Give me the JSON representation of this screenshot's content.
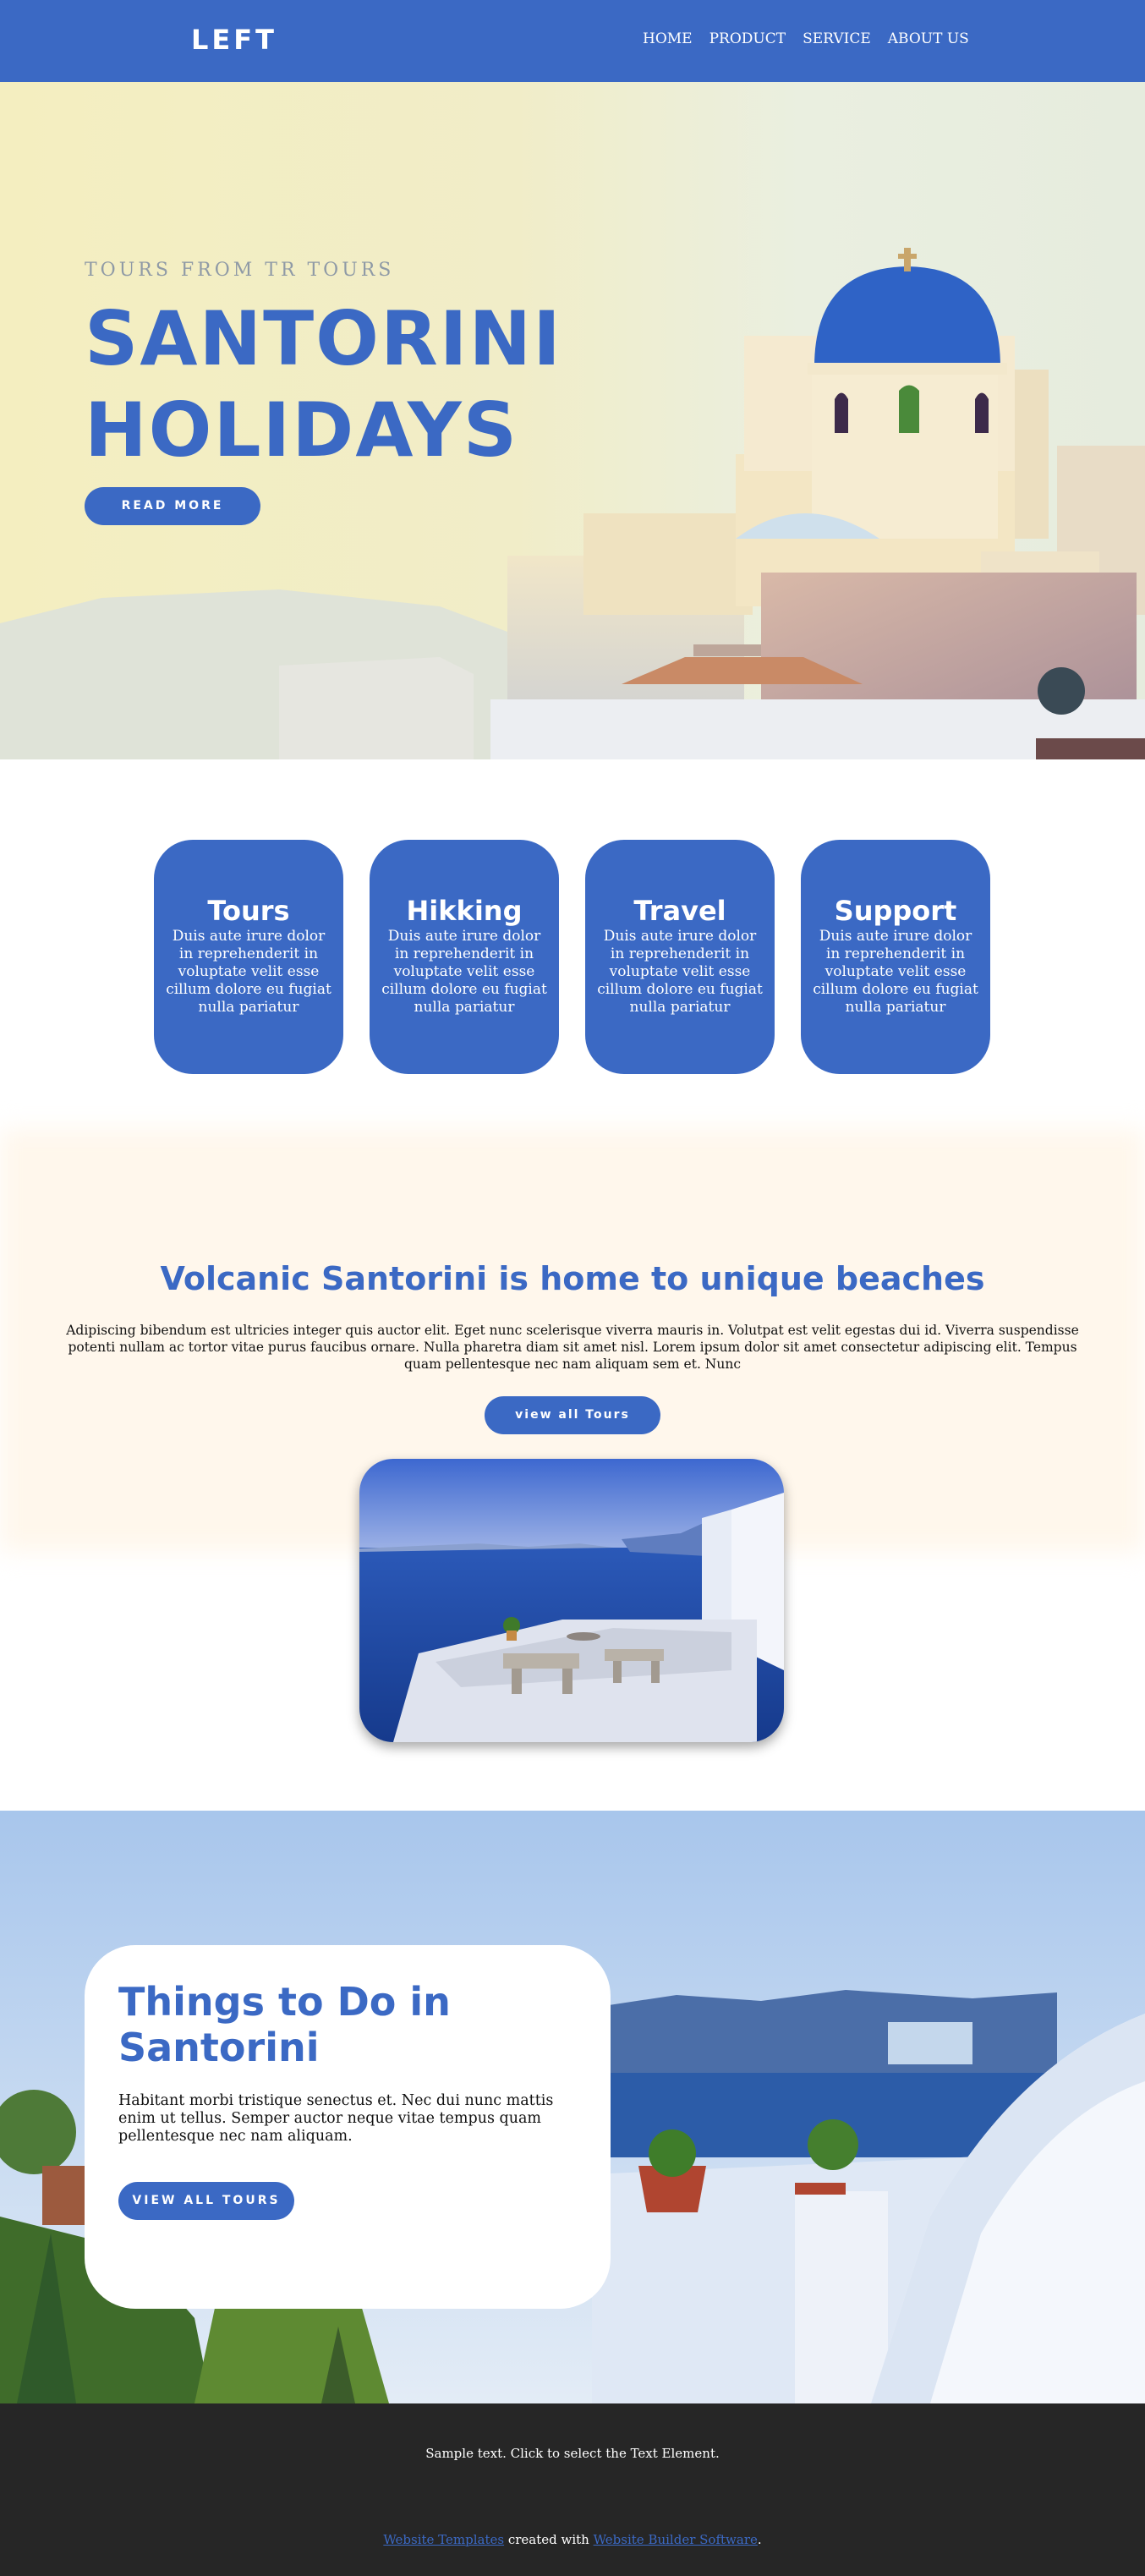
{
  "header": {
    "logo": "LEFT",
    "nav": [
      "HOME",
      "PRODUCT",
      "SERVICE",
      "ABOUT US"
    ]
  },
  "hero": {
    "subtitle": "TOURS FROM TR TOURS",
    "title_line1": "SANTORINI",
    "title_line2": "HOLIDAYS",
    "button": "READ MORE"
  },
  "features": [
    {
      "title": "Tours",
      "text": "Duis aute irure dolor in reprehenderit in voluptate velit esse cillum dolore eu fugiat nulla pariatur"
    },
    {
      "title": "Hikking",
      "text": "Duis aute irure dolor in reprehenderit in voluptate velit esse cillum dolore eu fugiat nulla pariatur"
    },
    {
      "title": "Travel",
      "text": "Duis aute irure dolor in reprehenderit in voluptate velit esse cillum dolore eu fugiat nulla pariatur"
    },
    {
      "title": "Support",
      "text": "Duis aute irure dolor in reprehenderit in voluptate velit esse cillum dolore eu fugiat nulla pariatur"
    }
  ],
  "beaches": {
    "title": "Volcanic Santorini is home to unique beaches",
    "text": "Adipiscing bibendum est ultricies integer quis auctor elit. Eget nunc scelerisque viverra mauris in. Volutpat est velit egestas dui id. Viverra suspendisse potenti nullam ac tortor vitae purus faucibus ornare. Nulla pharetra diam sit amet nisl. Lorem ipsum dolor sit amet consectetur adipiscing elit. Tempus quam pellentesque nec nam aliquam sem et. Nunc",
    "button": "view all Tours"
  },
  "things": {
    "title": "Things to Do in Santorini",
    "text": "Habitant morbi tristique senectus et. Nec dui nunc mattis enim ut tellus. Semper auctor neque vitae tempus quam pellentesque nec nam aliquam.",
    "button": "VIEW ALL TOURS"
  },
  "footer": {
    "text": "Sample text. Click to select the Text Element.",
    "credit_link1": "Website Templates",
    "credit_middle": " created with ",
    "credit_link2": "Website Builder Software",
    "credit_end": "."
  },
  "colors": {
    "accent": "#3b69c4",
    "footer_bg": "#262626",
    "section_bg": "#fff7ec"
  }
}
